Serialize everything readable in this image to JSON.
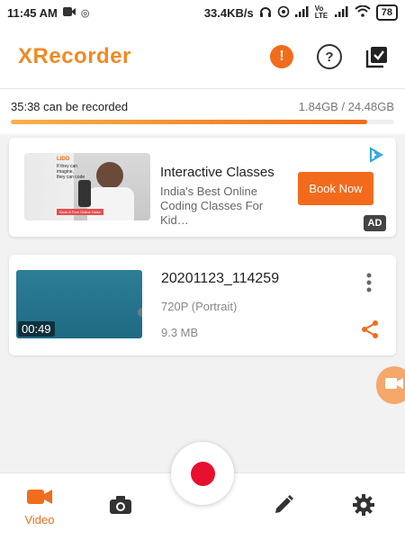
{
  "status_bar": {
    "time": "11:45 AM",
    "speed": "33.4KB/s",
    "network_label": "Vo LTE",
    "battery": "78"
  },
  "app_bar": {
    "logo": "XRecorder",
    "alert_icon": "alert-icon",
    "help_icon": "help-icon",
    "select_icon": "checklist-icon"
  },
  "storage": {
    "remaining_text": "35:38  can be recorded",
    "size_text": "1.84GB / 24.48GB",
    "used_fraction": 0.93
  },
  "ad": {
    "title": "Interactive Classes",
    "desc_line1": "India's Best Online",
    "desc_line2": "Coding Classes For Kid…",
    "button": "Book Now",
    "badge": "AD",
    "image_text_brand": "LIDO",
    "image_text_line1": "If they can",
    "image_text_line2": "imagine,",
    "image_text_line3": "they can code",
    "image_text_button": "Book A Free Online Class"
  },
  "videos": [
    {
      "name": "20201123_114259",
      "resolution": "720P (Portrait)",
      "size": "9.3 MB",
      "duration": "00:49"
    }
  ],
  "bottom_nav": {
    "video_label": "Video"
  },
  "colors": {
    "accent": "#f06d1c",
    "record": "#e8102f"
  }
}
